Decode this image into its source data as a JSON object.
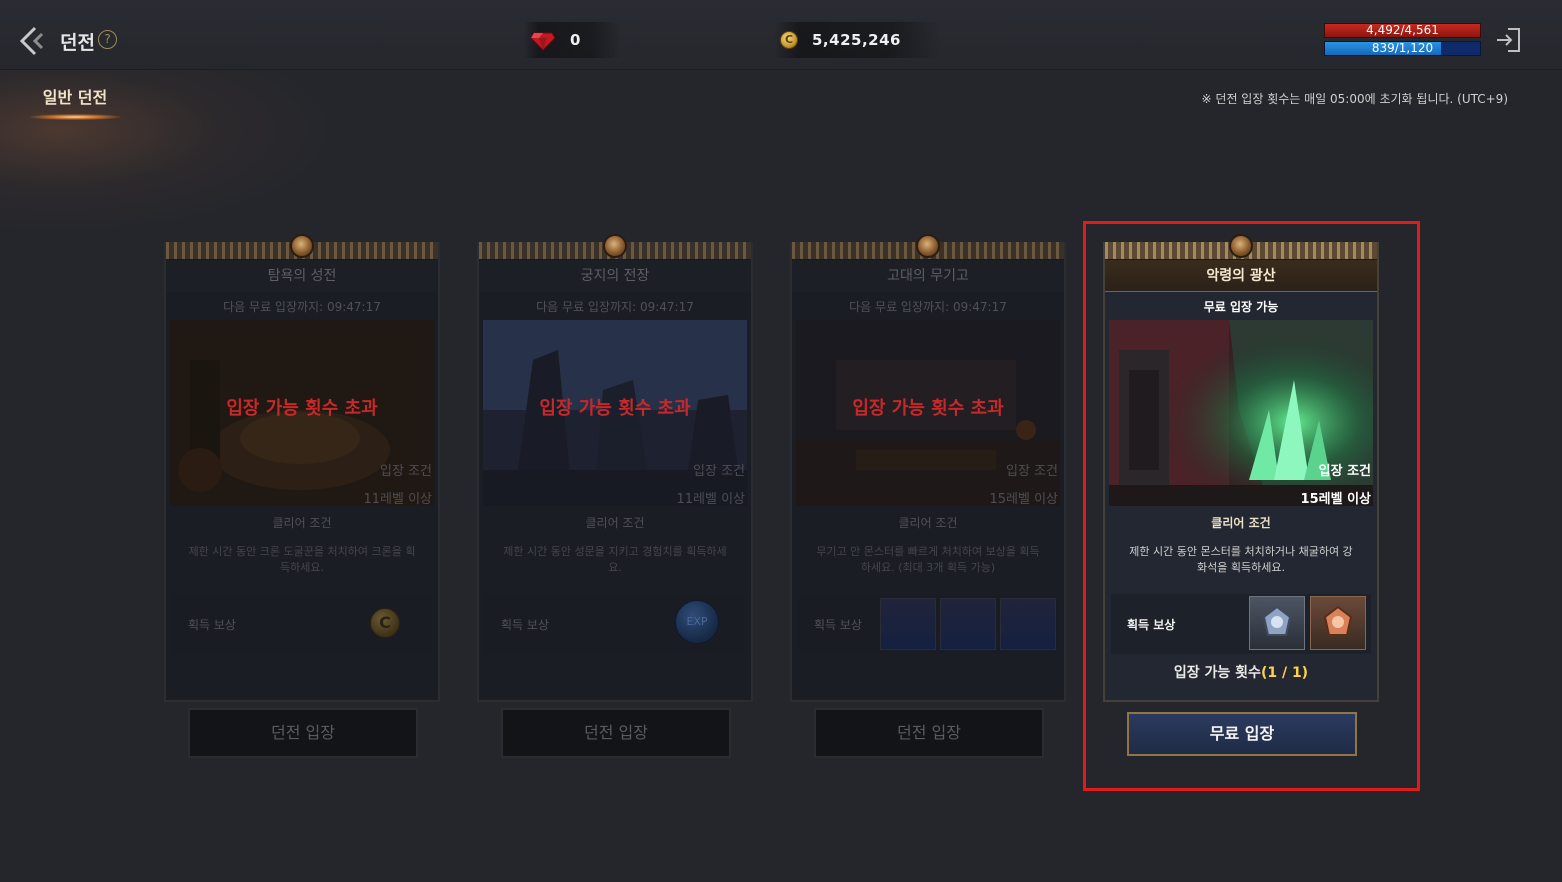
{
  "header": {
    "title": "던전",
    "help_icon": "?",
    "gem_count": "0",
    "gold_count": "5,425,246",
    "gold_icon_glyph": "C",
    "hp": {
      "text": "4,492/4,561",
      "value": 4492,
      "max": 4561
    },
    "mp": {
      "text": "839/1,120",
      "value": 839,
      "max": 1120
    }
  },
  "mode_tab": "일반 던전",
  "notice": "※ 던전 입장 횟수는 매일 05:00에 초기화 됩니다. (UTC+9)",
  "dungeons": [
    {
      "name": "탐욕의 성전",
      "status": "다음 무료 입장까지: 09:47:17",
      "overlay": "입장 가능 횟수 초과",
      "req_title": "입장 조건",
      "req_value": "11레벨 이상",
      "clear_title": "클리어 조건",
      "clear_desc": "제한 시간 동안 크론 도굴꾼을 처치하여 크론을 획득하세요.",
      "reward_label": "획득 보상",
      "button": "던전 입장"
    },
    {
      "name": "궁지의 전장",
      "status": "다음 무료 입장까지: 09:47:17",
      "overlay": "입장 가능 횟수 초과",
      "req_title": "입장 조건",
      "req_value": "11레벨 이상",
      "clear_title": "클리어 조건",
      "clear_desc": "제한 시간 동안 성문을 지키고 경험치를 획득하세요.",
      "reward_label": "획득 보상",
      "reward_icon_text": "EXP",
      "button": "던전 입장"
    },
    {
      "name": "고대의 무기고",
      "status": "다음 무료 입장까지: 09:47:17",
      "overlay": "입장 가능 횟수 초과",
      "req_title": "입장 조건",
      "req_value": "15레벨 이상",
      "clear_title": "클리어 조건",
      "clear_desc": "무기고 안 몬스터를 빠르게 처치하여 보상을 획득하세요. (최대 3개 획득 가능)",
      "reward_label": "획득 보상",
      "button": "던전 입장"
    },
    {
      "name": "악령의 광산",
      "status": "무료 입장 가능",
      "req_title": "입장 조건",
      "req_value": "15레벨 이상",
      "clear_title": "클리어 조건",
      "clear_desc": "제한 시간 동안 몬스터를 처치하거나 채굴하여 강화석을 획득하세요.",
      "reward_label": "획득 보상",
      "count_label": "입장 가능 횟수",
      "count_value": "(1 / 1)",
      "button": "무료 입장"
    }
  ]
}
